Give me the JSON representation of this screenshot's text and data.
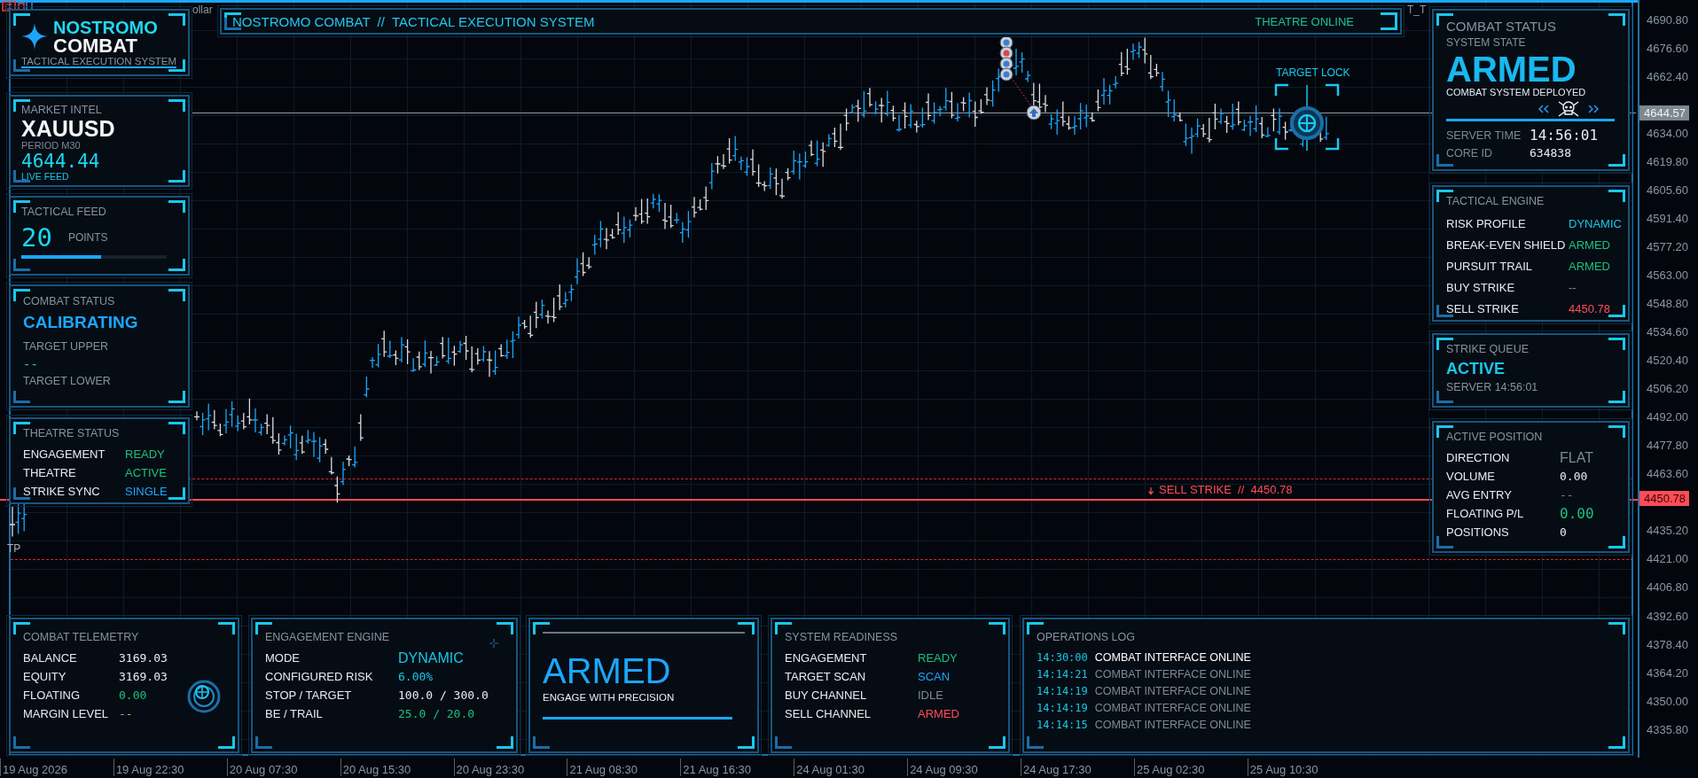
{
  "fragments": {
    "left": "ollar",
    "right": "T_T"
  },
  "logo": {
    "line1": "NOSTROMO",
    "line2": "COMBAT",
    "subtitle": "TACTICAL EXECUTION SYSTEM"
  },
  "header": {
    "title": "NOSTROMO COMBAT  //  TACTICAL EXECUTION SYSTEM",
    "status": "THEATRE ONLINE"
  },
  "market_intel": {
    "title": "MARKET INTEL",
    "symbol": "XAUUSD",
    "period": "PERIOD  M30",
    "price": "4644.44",
    "feed": "LIVE FEED"
  },
  "tactical_feed": {
    "title": "TACTICAL FEED",
    "value": "20",
    "unit": "POINTS",
    "level": 0.55
  },
  "combat_status_left": {
    "title": "COMBAT STATUS",
    "state": "CALIBRATING",
    "upper_label": "TARGET UPPER",
    "upper_value": "--",
    "lower_label": "TARGET LOWER"
  },
  "theatre_status": {
    "title": "THEATRE STATUS",
    "rows": [
      {
        "label": "ENGAGEMENT",
        "value": "READY",
        "color": "#19c37d",
        "kind": "text"
      },
      {
        "label": "THEATRE",
        "value": "ACTIVE",
        "color": "#19c37d",
        "kind": "text"
      },
      {
        "label": "STRIKE SYNC",
        "value": "SINGLE",
        "color": "#1aa7ff",
        "kind": "text"
      }
    ]
  },
  "combat_status": {
    "title": "COMBAT STATUS",
    "subtitle": "SYSTEM STATE",
    "state": "ARMED",
    "caption": "COMBAT SYSTEM DEPLOYED",
    "server_time_label": "SERVER TIME",
    "server_time": "14:56:01",
    "core_id_label": "CORE ID",
    "core_id": "634838"
  },
  "tactical_engine": {
    "title": "TACTICAL ENGINE",
    "rows": [
      {
        "label": "RISK PROFILE",
        "value": "DYNAMIC",
        "color": "#18c8e8",
        "kind": "text"
      },
      {
        "label": "BREAK-EVEN SHIELD",
        "value": "ARMED",
        "color": "#19c37d",
        "kind": "text"
      },
      {
        "label": "PURSUIT TRAIL",
        "value": "ARMED",
        "color": "#19c37d",
        "kind": "text"
      },
      {
        "label": "BUY STRIKE",
        "value": "--",
        "color": "#7d8a96",
        "kind": "text"
      },
      {
        "label": "SELL STRIKE",
        "value": "4450.78",
        "color": "#ff4d57",
        "kind": "text"
      }
    ]
  },
  "strike_queue": {
    "title": "STRIKE QUEUE",
    "state": "ACTIVE",
    "server": "SERVER  14:56:01"
  },
  "active_position": {
    "title": "ACTIVE POSITION",
    "rows": [
      {
        "label": "DIRECTION",
        "value": "FLAT",
        "color": "#7d8a96",
        "kind": "large"
      },
      {
        "label": "VOLUME",
        "value": "0.00",
        "color": "#e6edf3",
        "kind": "mono"
      },
      {
        "label": "AVG ENTRY",
        "value": "--",
        "color": "#7d8a96",
        "kind": "mono"
      },
      {
        "label": "FLOATING P/L",
        "value": "0.00",
        "color": "#19c37d",
        "kind": "large_mono"
      },
      {
        "label": "POSITIONS",
        "value": "0",
        "color": "#e6edf3",
        "kind": "mono"
      }
    ]
  },
  "telemetry": {
    "title": "COMBAT TELEMETRY",
    "rows": [
      {
        "label": "BALANCE",
        "value": "3169.03",
        "color": "#e6edf3",
        "kind": "mono"
      },
      {
        "label": "EQUITY",
        "value": "3169.03",
        "color": "#e6edf3",
        "kind": "mono"
      },
      {
        "label": "FLOATING",
        "value": "0.00",
        "color": "#19c37d",
        "kind": "mono"
      },
      {
        "label": "MARGIN LEVEL",
        "value": "--",
        "color": "#f0a020",
        "kind": "mono"
      }
    ]
  },
  "engagement_engine": {
    "title": "ENGAGEMENT ENGINE",
    "rows": [
      {
        "label": "MODE",
        "value": "DYNAMIC",
        "color": "#18c8e8",
        "kind": "large"
      },
      {
        "label": "CONFIGURED RISK",
        "value": "6.00%",
        "color": "#18c8e8",
        "kind": "mono"
      },
      {
        "label": "STOP / TARGET",
        "value": "100.0 / 300.0",
        "color": "#e6edf3",
        "kind": "mono"
      },
      {
        "label": "BE / TRAIL",
        "value": "25.0 / 20.0",
        "color": "#19c37d",
        "kind": "mono"
      }
    ]
  },
  "armed_banner": {
    "state": "ARMED",
    "caption": "ENGAGE WITH PRECISION"
  },
  "system_readiness": {
    "title": "SYSTEM READINESS",
    "rows": [
      {
        "label": "ENGAGEMENT",
        "value": "READY",
        "color": "#19c37d",
        "kind": "text"
      },
      {
        "label": "TARGET SCAN",
        "value": "SCAN",
        "color": "#1aa7ff",
        "kind": "text"
      },
      {
        "label": "BUY CHANNEL",
        "value": "IDLE",
        "color": "#7d8a96",
        "kind": "text"
      },
      {
        "label": "SELL CHANNEL",
        "value": "ARMED",
        "color": "#ff4d57",
        "kind": "text"
      }
    ]
  },
  "operations_log": {
    "title": "OPERATIONS LOG",
    "entries": [
      {
        "time": "14:30:00",
        "message": "COMBAT INTERFACE ONLINE",
        "selected": true
      },
      {
        "time": "14:14:21",
        "message": "COMBAT INTERFACE ONLINE",
        "selected": false
      },
      {
        "time": "14:14:19",
        "message": "COMBAT INTERFACE ONLINE",
        "selected": false
      },
      {
        "time": "14:14:19",
        "message": "COMBAT INTERFACE ONLINE",
        "selected": false
      },
      {
        "time": "14:14:15",
        "message": "COMBAT INTERFACE ONLINE",
        "selected": false
      }
    ]
  },
  "chart": {
    "tp_label": "TP",
    "target_lock": "TARGET LOCK",
    "sell_line_label": "SELL STRIKE  //  4450.78",
    "price_axis": [
      {
        "kind": "tick",
        "label": "4690.80"
      },
      {
        "kind": "tick",
        "label": "4676.60"
      },
      {
        "kind": "tick",
        "label": "4662.40"
      },
      {
        "kind": "last_tag",
        "label": "4644.57"
      },
      {
        "kind": "tick",
        "label": "4634.00"
      },
      {
        "kind": "tick",
        "label": "4619.80"
      },
      {
        "kind": "tick",
        "label": "4605.60"
      },
      {
        "kind": "tick",
        "label": "4591.40"
      },
      {
        "kind": "tick",
        "label": "4577.20"
      },
      {
        "kind": "tick",
        "label": "4563.00"
      },
      {
        "kind": "tick",
        "label": "4548.80"
      },
      {
        "kind": "tick",
        "label": "4534.60"
      },
      {
        "kind": "tick",
        "label": "4520.40"
      },
      {
        "kind": "tick",
        "label": "4506.20"
      },
      {
        "kind": "tick",
        "label": "4492.00"
      },
      {
        "kind": "tick",
        "label": "4477.80"
      },
      {
        "kind": "tick",
        "label": "4463.60"
      },
      {
        "kind": "sell_tag",
        "label": "4450.78"
      },
      {
        "kind": "tick",
        "label": "4435.20"
      },
      {
        "kind": "tick",
        "label": "4421.00"
      },
      {
        "kind": "tick",
        "label": "4406.80"
      },
      {
        "kind": "tick",
        "label": "4392.60"
      },
      {
        "kind": "tick",
        "label": "4378.40"
      },
      {
        "kind": "tick",
        "label": "4364.20"
      },
      {
        "kind": "tick",
        "label": "4350.00"
      },
      {
        "kind": "tick",
        "label": "4335.80"
      }
    ],
    "time_axis": [
      "19 Aug 2026",
      "19 Aug 22:30",
      "20 Aug 07:30",
      "20 Aug 15:30",
      "20 Aug 23:30",
      "21 Aug 08:30",
      "21 Aug 16:30",
      "24 Aug 01:30",
      "24 Aug 09:30",
      "24 Aug 17:30",
      "25 Aug 02:30",
      "25 Aug 10:30"
    ]
  }
}
